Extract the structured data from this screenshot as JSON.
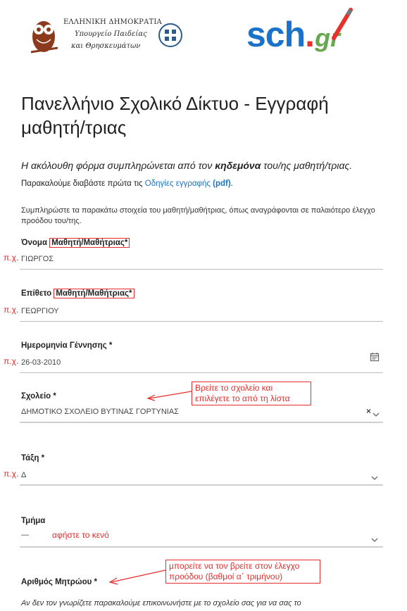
{
  "header": {
    "ministry_line1": "ΕΛΛΗΝΙΚΗ ΔΗΜΟΚΡΑΤΙΑ",
    "ministry_line2": "Υπουργείο Παιδείας",
    "ministry_line3": "και Θρησκευμάτων",
    "sch_main": "sch",
    "sch_dot": ".",
    "sch_gr": "gr"
  },
  "page_title": "Πανελλήνιο Σχολικό Δίκτυο - Εγγραφή μαθητή/τριας",
  "intro": {
    "part1": "Η ακόλουθη φόρμα συμπληρώνεται από τον ",
    "bold": "κηδεμόνα",
    "part2": " του/ης μαθητή/τριας",
    "period": ".",
    "part3": " Παρακαλούμε διαβάστε πρώτα τις ",
    "link": "Οδηγίες εγγραφής",
    "pdf": " (pdf)",
    "end": "."
  },
  "hint": "Συμπληρώστε τα παρακάτω στοιχεία του μαθητή/μαθήτριας, όπως αναγράφονται σε παλαιότερο έλεγχο προόδου του/της.",
  "example_prefix": "π.χ.",
  "fields": {
    "first_name": {
      "label_pre": "Όνομα ",
      "label_box": "Μαθητή/Μαθήτριας*",
      "value": "ΓΙΩΡΓΟΣ"
    },
    "last_name": {
      "label_pre": "Επίθετο ",
      "label_box": "Μαθητή/Μαθήτριας*",
      "value": "ΓΕΩΡΓΙΟΥ"
    },
    "birthdate": {
      "label": "Ημερομηνία Γέννησης *",
      "value": "26-03-2010"
    },
    "school": {
      "label": "Σχολείο *",
      "value": "ΔΗΜΟΤΙΚΟ ΣΧΟΛΕΙΟ ΒΥΤΙΝΑΣ ΓΟΡΤΥΝΙΑΣ",
      "clear": "×",
      "note": "Βρείτε το σχολείο και επιλέγετε το από τη λίστα"
    },
    "grade": {
      "label": "Τάξη *",
      "value": "Δ"
    },
    "section": {
      "label": "Τμήμα",
      "value": "—",
      "note": "αφήστε το κενό"
    },
    "registry": {
      "label": "Αριθμός Μητρώου *",
      "note": "μπορείτε να τον βρείτε στον έλεγχο προόδου (βαθμοί α΄ τριμήνου)"
    }
  },
  "footer_text": "Αν δεν τον γνωρίζετε παρακαλούμε επικοινωνήστε με το σχολείο σας για να σας το",
  "icons": {
    "calendar": "calendar-icon",
    "chevron": "chevron-down-icon",
    "clear": "clear-icon"
  },
  "colors": {
    "accent": "#1a73c8",
    "annotation": "#e52d2d",
    "logo_green": "#6aa84f"
  }
}
